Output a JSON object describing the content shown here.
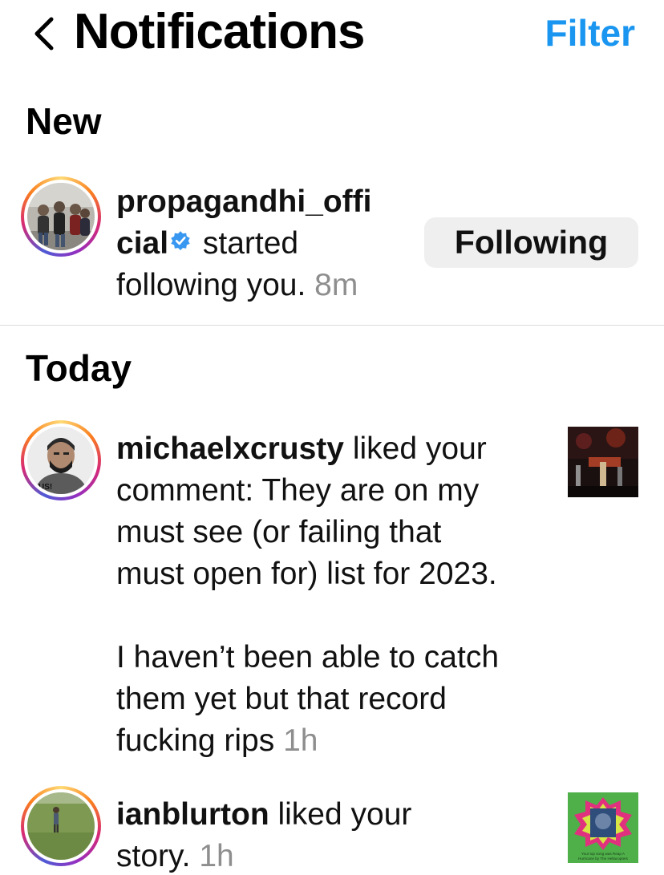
{
  "header": {
    "title": "Notifications",
    "filter_label": "Filter"
  },
  "sections": {
    "new_title": "New",
    "today_title": "Today"
  },
  "notifications": [
    {
      "username_line1": "propagandhi_offi",
      "username_line2": "cial",
      "verified": true,
      "action_line2": " started",
      "action_line3": "following you.",
      "time": "8m",
      "button_label": "Following"
    },
    {
      "username": "michaelxcrusty",
      "lines": [
        " liked your",
        "comment: They are on my",
        "must see (or failing that",
        "must open for) list for 2023.",
        "I haven’t been able to catch",
        "them yet but that record",
        "fucking rips"
      ],
      "time": "1h"
    },
    {
      "username": "ianblurton",
      "line1_rest": " liked your",
      "line2": "story.",
      "time": "1h",
      "thumb_caption": "Your top song was Reap A Hurricane by The Hellacopters"
    }
  ],
  "colors": {
    "accent": "#1a96f0",
    "time_gray": "#8e8e8e",
    "button_bg": "#efefef",
    "verified_blue": "#3897f0"
  },
  "icons": {
    "back": "chevron-left-icon",
    "verified": "verified-badge-icon"
  }
}
